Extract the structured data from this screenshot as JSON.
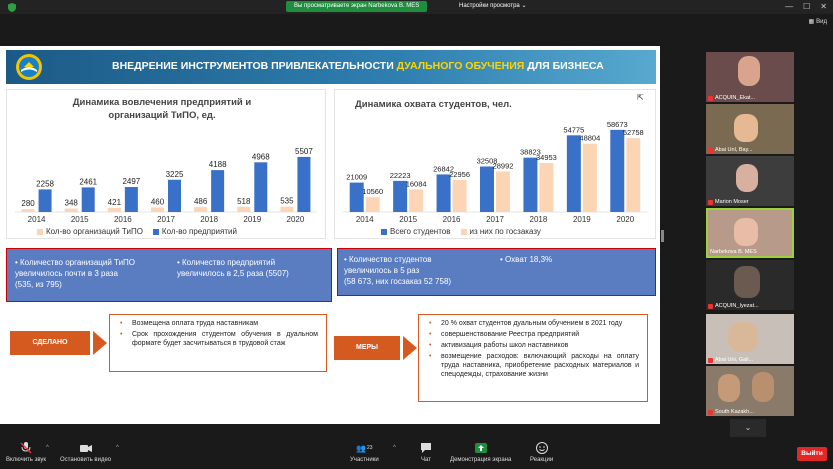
{
  "topbar": {
    "share_notice": "Вы просматриваете экран Narbekova B. MES",
    "share_settings": "Настройки просмотра",
    "view_label": "Вид"
  },
  "slide": {
    "title_part1": "ВНЕДРЕНИЕ ИНСТРУМЕНТОВ ПРИВЛЕКАТЕЛЬНОСТИ ",
    "title_highlight": "ДУАЛЬНОГО ОБУЧЕНИЯ",
    "title_part2": " ДЛЯ БИЗНЕСА",
    "box1": {
      "left_lines": [
        "•   Количество организаций ТиПО",
        "увеличилось почти в  3 раза",
        "(535, из 795)"
      ],
      "right_lines": [
        "•   Количество предприятий",
        "увеличилось в 2,5 раза (5507)"
      ]
    },
    "box2": {
      "left_lines": [
        "•   Количество студентов",
        "увеличилось в 5 раз",
        "(58 673, них госзаказ 52 758)"
      ],
      "right_lines": [
        "•   Охват  18,3%"
      ]
    },
    "done_label": "СДЕЛАНО",
    "measures_label": "МЕРЫ",
    "done_items": [
      "Возмещена  оплата труда наставникам",
      "Срок  прохождения  студентом  обучения  в дуальном  формате  будет  засчитываться  в трудовой стаж"
    ],
    "measures_items": [
      "20 %  охват студентов дуальным обучением    в 2021 году",
      "совершенствование Реестра предприятий",
      "активизация работы школ наставников",
      "возмещение  расходов:  включающий  расходы  на оплату  труда  наставника,  приобретение  расходных материалов и спецодежды, страхование жизни"
    ]
  },
  "chart_data": [
    {
      "type": "bar",
      "title": "Динамика вовлечения  предприятий и организаций ТиПО, ед.",
      "categories": [
        "2014",
        "2015",
        "2016",
        "2017",
        "2018",
        "2019",
        "2020"
      ],
      "series": [
        {
          "name": "Кол-во организаций ТиПО",
          "values": [
            280,
            348,
            421,
            460,
            486,
            518,
            535
          ],
          "color": "#fcd5b5"
        },
        {
          "name": "Кол-во предприятий",
          "values": [
            2258,
            2461,
            2497,
            3225,
            4188,
            4968,
            5507
          ],
          "color": "#3a71c8"
        }
      ],
      "ylim": [
        0,
        5600
      ],
      "legend": "bottom"
    },
    {
      "type": "bar",
      "title": "Динамика охвата студентов, чел.",
      "categories": [
        "2014",
        "2015",
        "2016",
        "2017",
        "2018",
        "2019",
        "2020"
      ],
      "series": [
        {
          "name": "Всего студентов",
          "values": [
            21009,
            22223,
            26842,
            32508,
            38823,
            54775,
            58673
          ],
          "color": "#3a71c8"
        },
        {
          "name": "из них по госзаказу",
          "values": [
            10560,
            16084,
            22956,
            28992,
            34953,
            48804,
            52758
          ],
          "color": "#fcd5b5"
        }
      ],
      "ylim": [
        0,
        60000
      ],
      "legend": "bottom"
    }
  ],
  "participants": [
    {
      "name": "ACQUIN_Ekat..."
    },
    {
      "name": "Abai Unl, Bay..."
    },
    {
      "name": "Marion Moser"
    },
    {
      "name": "Narbekova B. MES"
    },
    {
      "name": "ACQUIN_Iyezat..."
    },
    {
      "name": "Abai Uni, Gali..."
    },
    {
      "name": "South Kazakh..."
    }
  ],
  "bottombar": {
    "audio_label": "Включить звук",
    "video_label": "Остановить видео",
    "participants_label": "Участники",
    "participants_count": "23",
    "chat_label": "Чат",
    "share_label": "Демонстрация экрана",
    "reactions_label": "Реакции",
    "leave_label": "Выйти"
  },
  "colors": {
    "accent_green": "#1e8e3e",
    "leave_red": "#e02828",
    "slide_orange": "#d45a1f",
    "box_blue": "#5a7cc0"
  }
}
